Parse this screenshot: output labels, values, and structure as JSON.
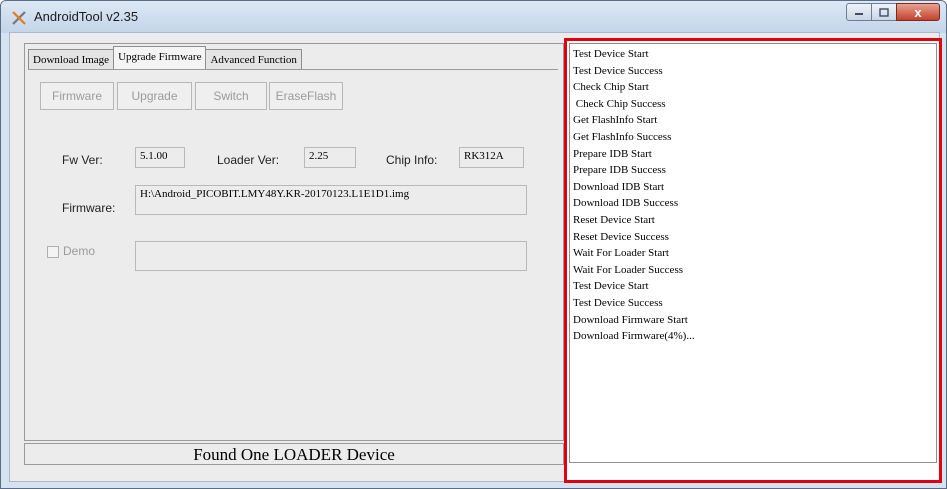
{
  "window": {
    "title": "AndroidTool v2.35",
    "close_glyph": "x"
  },
  "tabs": [
    {
      "label": "Download Image",
      "active": false
    },
    {
      "label": "Upgrade Firmware",
      "active": true
    },
    {
      "label": "Advanced Function",
      "active": false
    }
  ],
  "buttons": {
    "firmware": "Firmware",
    "upgrade": "Upgrade",
    "switch": "Switch",
    "erase": "EraseFlash"
  },
  "info": {
    "fw_ver_label": "Fw Ver:",
    "fw_ver": "5.1.00",
    "loader_ver_label": "Loader Ver:",
    "loader_ver": "2.25",
    "chip_info_label": "Chip Info:",
    "chip_info": "RK312A",
    "firmware_label": "Firmware:",
    "firmware_path": "H:\\Android_PICOBIT.LMY48Y.KR-20170123.L1E1D1.img",
    "demo_label": "Demo",
    "demo_value": ""
  },
  "status": "Found One LOADER Device",
  "log": [
    "Test Device Start",
    "Test Device Success",
    "Check Chip Start",
    " Check Chip Success",
    "Get FlashInfo Start",
    "Get FlashInfo Success",
    "Prepare IDB Start",
    "Prepare IDB Success",
    "Download IDB Start",
    "Download IDB Success",
    "Reset Device Start",
    "Reset Device Success",
    "Wait For Loader Start",
    "Wait For Loader Success",
    "Test Device Start",
    "Test Device Success",
    "Download Firmware Start",
    "Download Firmware(4%)..."
  ],
  "colors": {
    "log_highlight": "#e3000f",
    "disabled_text": "#9b9b9b"
  }
}
